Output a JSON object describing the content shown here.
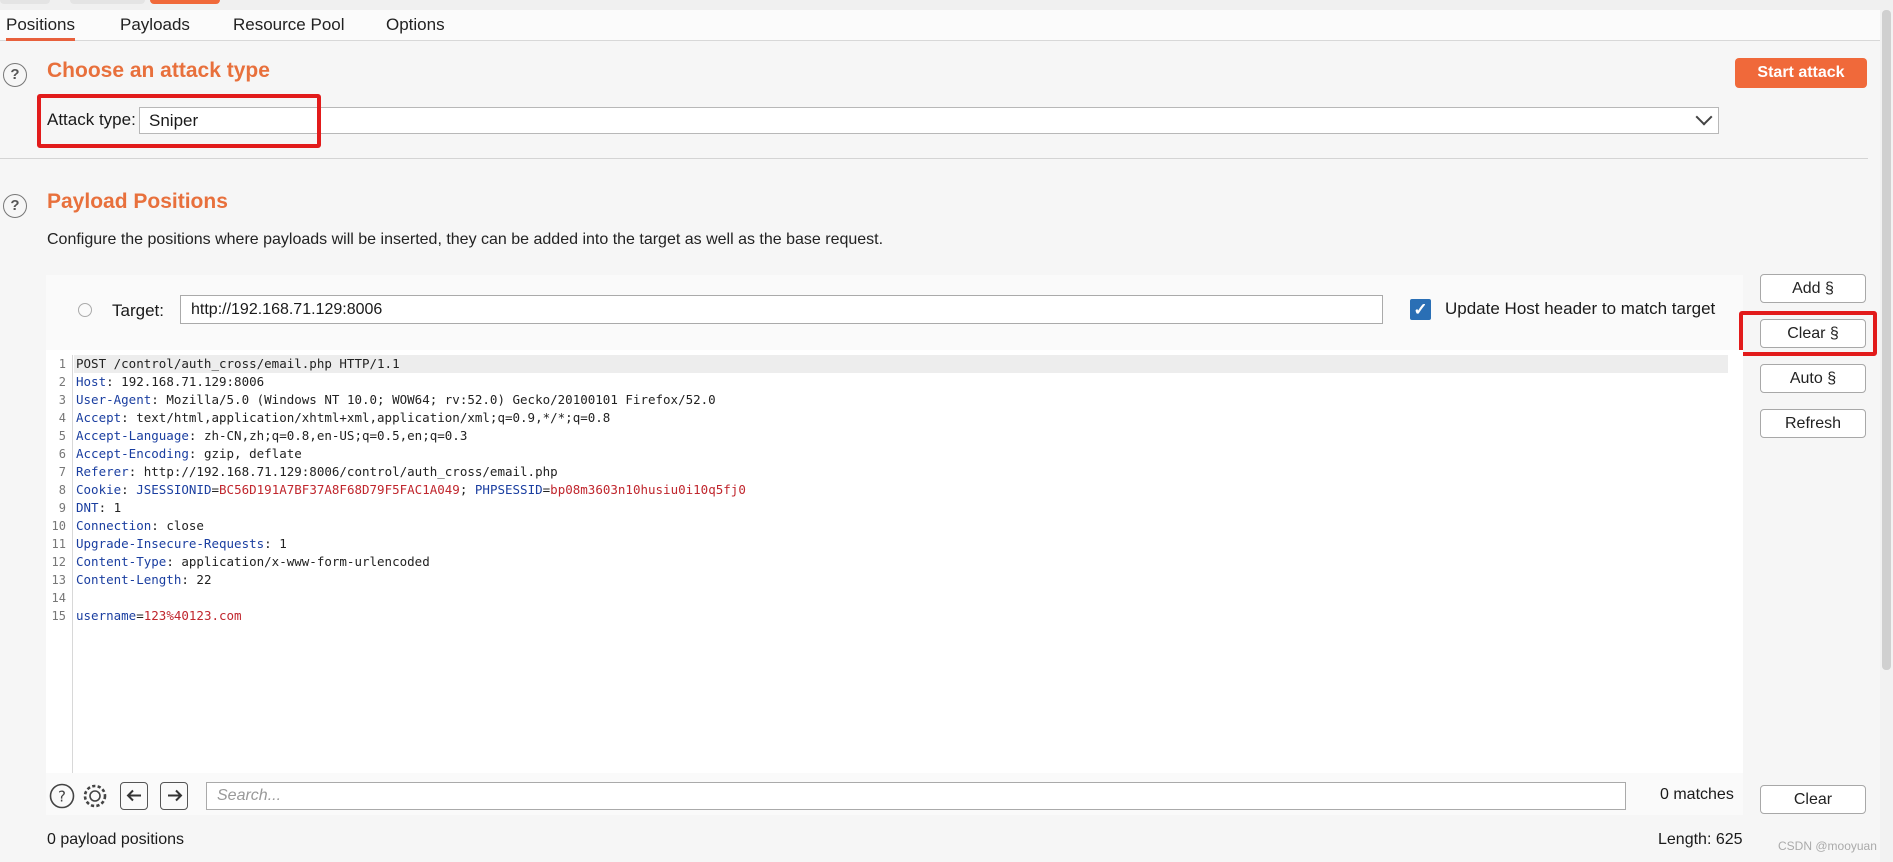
{
  "tabs": [
    {
      "label": "Positions"
    },
    {
      "label": "Payloads"
    },
    {
      "label": "Resource Pool"
    },
    {
      "label": "Options"
    }
  ],
  "attack_section": {
    "title": "Choose an attack type",
    "start_button": "Start attack",
    "attack_type_label": "Attack type:",
    "attack_type_value": "Sniper"
  },
  "positions_section": {
    "title": "Payload Positions",
    "description": "Configure the positions where payloads will be inserted, they can be added into the target as well as the base request.",
    "target_label": "Target:",
    "target_value": "http://192.168.71.129:8006",
    "update_host_label": "Update Host header to match target",
    "update_host_checked": true
  },
  "side_buttons": {
    "add": "Add §",
    "clear": "Clear §",
    "auto": "Auto §",
    "refresh": "Refresh"
  },
  "request_lines": [
    {
      "n": "1",
      "text": "POST /control/auth_cross/email.php HTTP/1.1"
    },
    {
      "n": "2",
      "name": "Host",
      "value": " 192.168.71.129:8006"
    },
    {
      "n": "3",
      "name": "User-Agent",
      "value": " Mozilla/5.0 (Windows NT 10.0; WOW64; rv:52.0) Gecko/20100101 Firefox/52.0"
    },
    {
      "n": "4",
      "name": "Accept",
      "value": " text/html,application/xhtml+xml,application/xml;q=0.9,*/*;q=0.8"
    },
    {
      "n": "5",
      "name": "Accept-Language",
      "value": " zh-CN,zh;q=0.8,en-US;q=0.5,en;q=0.3"
    },
    {
      "n": "6",
      "name": "Accept-Encoding",
      "value": " gzip, deflate"
    },
    {
      "n": "7",
      "name": "Referer",
      "value": " http://192.168.71.129:8006/control/auth_cross/email.php"
    },
    {
      "n": "8",
      "name": "Cookie",
      "c1name": "JSESSIONID",
      "c1val": "BC56D191A7BF37A8F68D79F5FAC1A049",
      "c2name": "PHPSESSID",
      "c2val": "bp08m3603n10husiu0i10q5fj0"
    },
    {
      "n": "9",
      "name": "DNT",
      "value": " 1"
    },
    {
      "n": "10",
      "name": "Connection",
      "value": " close"
    },
    {
      "n": "11",
      "name": "Upgrade-Insecure-Requests",
      "value": " 1"
    },
    {
      "n": "12",
      "name": "Content-Type",
      "value": " application/x-www-form-urlencoded"
    },
    {
      "n": "13",
      "name": "Content-Length",
      "value": " 22"
    },
    {
      "n": "14"
    },
    {
      "n": "15",
      "pname": "username",
      "pval": "123%40123.com"
    }
  ],
  "search": {
    "placeholder": "Search...",
    "matches": "0 matches",
    "clear_button": "Clear"
  },
  "footer": {
    "payload_positions": "0 payload positions",
    "length": "Length: 625"
  },
  "watermark": "CSDN @mooyuan",
  "colors": {
    "accent": "#f0693a",
    "highlight_box": "#e21b1b",
    "header_name": "#1a3ea0",
    "cookie_value": "#c0262d",
    "checkbox": "#2a6fb5"
  }
}
